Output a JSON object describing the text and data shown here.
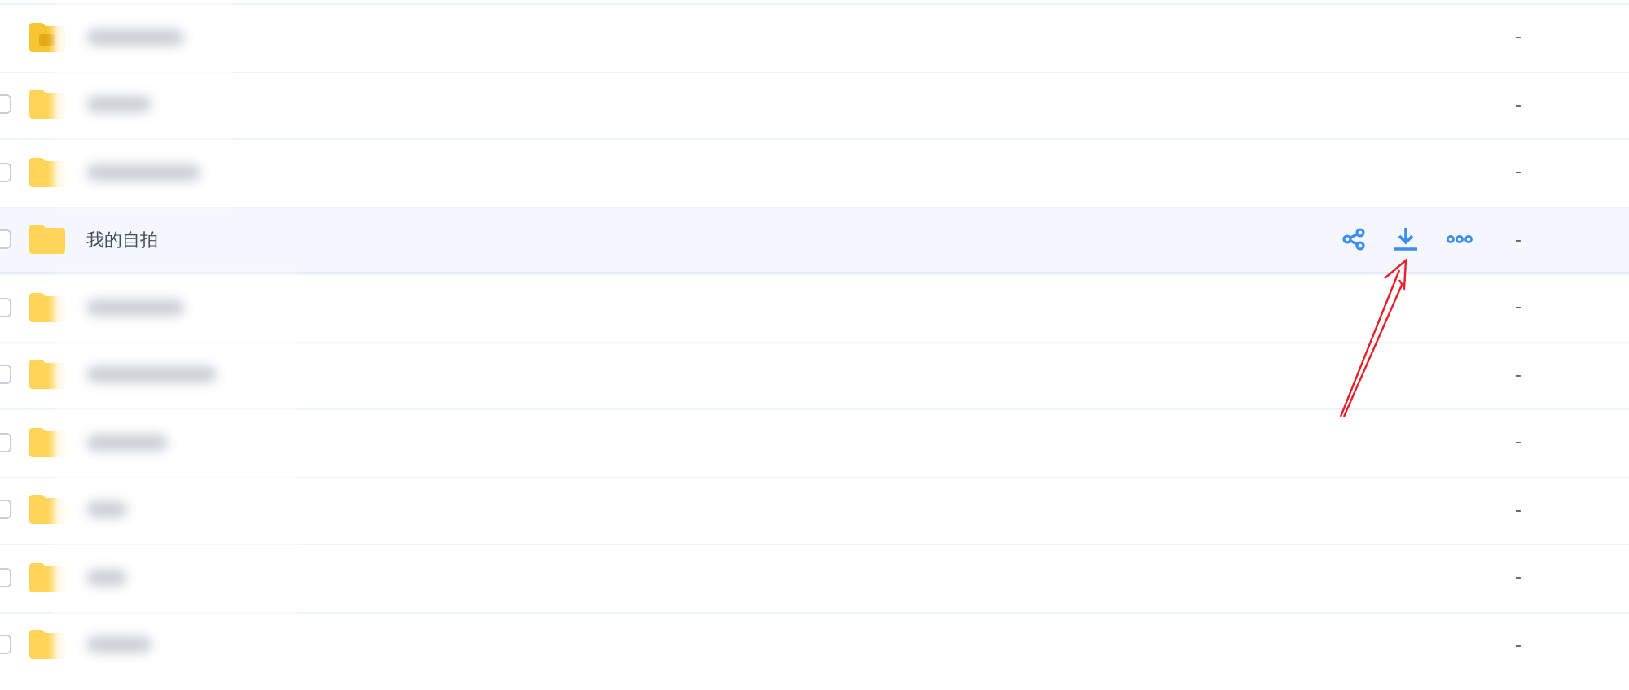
{
  "files": [
    {
      "kind": "app-folder",
      "name_blurred": true,
      "hovered": false,
      "size": "-"
    },
    {
      "kind": "folder",
      "name_blurred": true,
      "checked": false,
      "hovered": false,
      "size": "-"
    },
    {
      "kind": "folder",
      "name_blurred": true,
      "checked": false,
      "hovered": false,
      "size": "-"
    },
    {
      "kind": "folder",
      "name": "我的自拍",
      "checked": false,
      "hovered": true,
      "size": "-"
    },
    {
      "kind": "folder",
      "name_blurred": true,
      "checked": false,
      "hovered": false,
      "size": "-"
    },
    {
      "kind": "folder",
      "name_blurred": true,
      "checked": false,
      "hovered": false,
      "size": "-"
    },
    {
      "kind": "folder",
      "name_blurred": true,
      "checked": false,
      "hovered": false,
      "size": "-"
    },
    {
      "kind": "folder",
      "name_blurred": true,
      "checked": false,
      "hovered": false,
      "size": "-"
    },
    {
      "kind": "folder",
      "name_blurred": true,
      "checked": false,
      "hovered": false,
      "size": "-"
    },
    {
      "kind": "folder",
      "name_blurred": true,
      "checked": false,
      "hovered": false,
      "size": "-"
    }
  ],
  "annotation": {
    "kind": "arrow"
  }
}
